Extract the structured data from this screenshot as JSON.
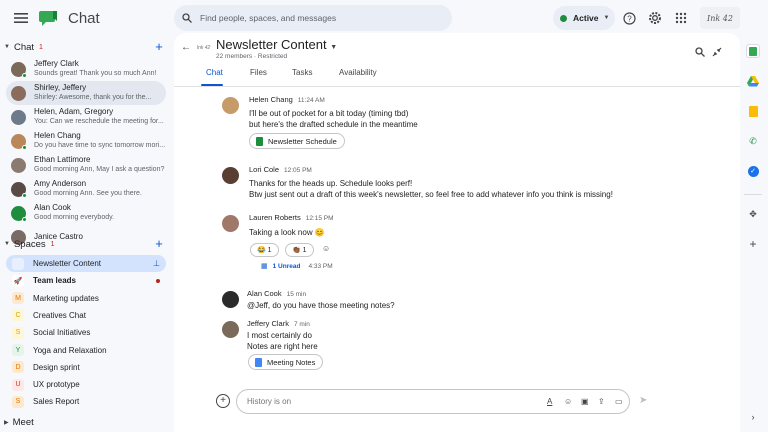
{
  "app": {
    "title": "Chat"
  },
  "search": {
    "placeholder": "Find people, spaces, and messages"
  },
  "status": {
    "label": "Active",
    "color": "#1e8e3e"
  },
  "account": {
    "signature": "Ink 42"
  },
  "sidebar": {
    "chat_heading": "Chat",
    "chat_badge": "1",
    "dms": [
      {
        "name": "Jeffery Clark",
        "preview": "Sounds great! Thank you so much Ann!",
        "online": true,
        "color": "#7b6a5a"
      },
      {
        "name": "Shirley, Jeffery",
        "preview": "Shirley: Awesome, thank you for the...",
        "online": false,
        "color": "#8a6b5c"
      },
      {
        "name": "Helen, Adam, Gregory",
        "preview": "You: Can we reschedule the meeting for...",
        "online": false,
        "color": "#6d7a8a"
      },
      {
        "name": "Helen Chang",
        "preview": "Do you have time to sync tomorrow mori...",
        "online": true,
        "color": "#b9875a"
      },
      {
        "name": "Ethan Lattimore",
        "preview": "Good morning Ann, May I ask a question?",
        "online": false,
        "color": "#8b7a70"
      },
      {
        "name": "Amy Anderson",
        "preview": "Good morning Ann. See you there.",
        "online": true,
        "color": "#5a4a46"
      },
      {
        "name": "Alan Cook",
        "preview": "Good morning everybody.",
        "online": true,
        "color": "#1e8e3e"
      },
      {
        "name": "Janice Castro",
        "preview": "",
        "online": false,
        "color": "#7a6a66"
      }
    ],
    "spaces_heading": "Spaces",
    "spaces_badge": "1",
    "spaces": [
      {
        "name": "Newsletter Content",
        "icon": "newsletter-thumb",
        "letter": "",
        "bg": "#e8f0fe",
        "fg": "#5f6368",
        "bold": false,
        "selected": true,
        "pinned": true
      },
      {
        "name": "Team leads",
        "icon": "rocket-icon",
        "letter": "🚀",
        "bg": "#fff",
        "fg": "#c5221f",
        "bold": true,
        "selected": false,
        "unread": true
      },
      {
        "name": "Marketing updates",
        "icon": "letter-m-icon",
        "letter": "M",
        "bg": "#fde9cf",
        "fg": "#e37400",
        "bold": false
      },
      {
        "name": "Creatives Chat",
        "icon": "letter-c-icon",
        "letter": "C",
        "bg": "#fef7d6",
        "fg": "#e2a600",
        "bold": false
      },
      {
        "name": "Social Initiatives",
        "icon": "letter-s-icon",
        "letter": "S",
        "bg": "#fef7d6",
        "fg": "#e2a600",
        "bold": false
      },
      {
        "name": "Yoga and Relaxation",
        "icon": "letter-y-icon",
        "letter": "Y",
        "bg": "#e6f4ea",
        "fg": "#1e8e3e",
        "bold": false
      },
      {
        "name": "Design sprint",
        "icon": "letter-d-icon",
        "letter": "D",
        "bg": "#fde9cf",
        "fg": "#e37400",
        "bold": false
      },
      {
        "name": "UX prototype",
        "icon": "letter-u-icon",
        "letter": "U",
        "bg": "#fce8e6",
        "fg": "#d93025",
        "bold": false
      },
      {
        "name": "Sales Report",
        "icon": "letter-s-icon",
        "letter": "S",
        "bg": "#fde9cf",
        "fg": "#e37400",
        "bold": false
      }
    ],
    "meet_heading": "Meet"
  },
  "space": {
    "title": "Newsletter Content",
    "subtitle": "22 members · Restricted",
    "thumb_text": "Ink 42",
    "tabs": [
      "Chat",
      "Files",
      "Tasks",
      "Availability"
    ]
  },
  "messages": [
    {
      "name": "Helen Chang",
      "time": "11:24 AM",
      "lines": [
        "I'll be out of pocket for a bit today (timing tbd)",
        " but here's the drafted schedule in the meantime"
      ],
      "chip": "Newsletter Schedule",
      "chip_color": "#1e8e3e",
      "avatar_color": "#c79a6a"
    },
    {
      "name": "Lori Cole",
      "time": "12:05 PM",
      "lines": [
        "Thanks for the heads up. Schedule looks perf!",
        "Btw just sent out a draft of this week's newsletter, so feel free to add whatever info you think is missing!"
      ],
      "avatar_color": "#5a3e34"
    },
    {
      "name": "Lauren Roberts",
      "time": "12:15 PM",
      "lines": [
        "Taking a look now 😊"
      ],
      "reactions": [
        {
          "emoji": "😂",
          "count": "1"
        },
        {
          "emoji": "👏🏾",
          "count": "1"
        }
      ],
      "thread_unread": "1 Unread",
      "thread_time": "4:33 PM",
      "avatar_color": "#a0786a"
    },
    {
      "name": "Alan Cook",
      "time": "15 min",
      "lines": [
        "@Jeff, do you have those meeting notes?"
      ],
      "avatar_color": "#2b2b2b"
    },
    {
      "name": "Jeffery Clark",
      "time": "7 min",
      "lines": [
        "I most certainly do",
        "Notes are right here"
      ],
      "chip": "Meeting Notes",
      "chip_color": "#4285f4",
      "avatar_color": "#7b6a5a"
    }
  ],
  "composer": {
    "placeholder": "History is on"
  },
  "rail": {
    "icons": [
      "sheets-icon",
      "drive-icon",
      "keep-icon",
      "phone-icon",
      "tasks-icon",
      "puzzle-icon",
      "add-icon",
      "expand-icon"
    ]
  }
}
